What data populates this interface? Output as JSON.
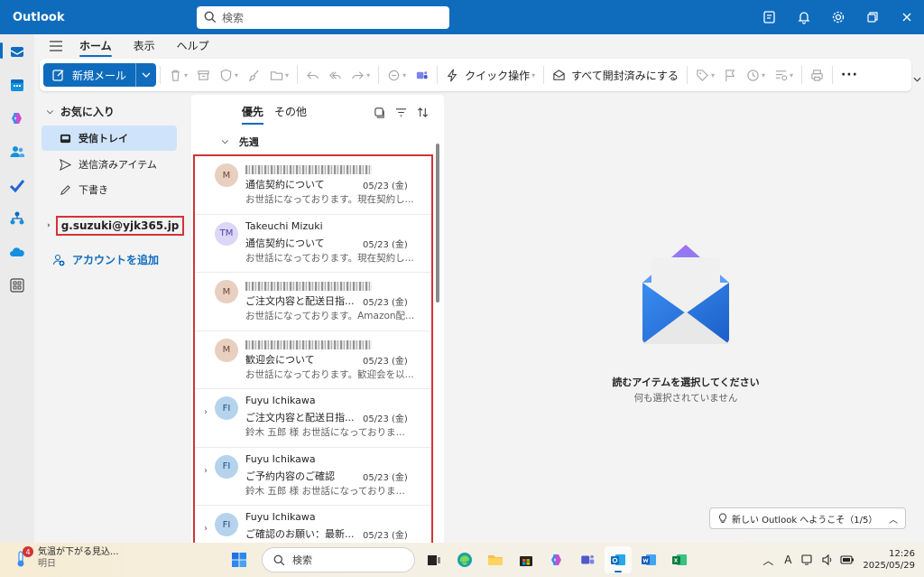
{
  "app": {
    "title": "Outlook"
  },
  "search": {
    "placeholder": "検索"
  },
  "ribbon": {
    "tabs": [
      "ホーム",
      "表示",
      "ヘルプ"
    ],
    "new_mail": "新規メール",
    "quick_steps": "クイック操作",
    "mark_all_read": "すべて開封済みにする"
  },
  "folders": {
    "favorites": "お気に入り",
    "items": [
      "受信トレイ",
      "送信済みアイテム",
      "下書き"
    ],
    "account": "g.suzuki@yjk365.jp",
    "add_account": "アカウントを追加"
  },
  "list": {
    "tabs": [
      "優先",
      "その他"
    ],
    "group": "先週",
    "messages": [
      {
        "initials": "M",
        "sender": "",
        "subject": "通信契約について",
        "date": "05/23 (金)",
        "preview": "お世話になっております。現在契約し...",
        "avatar_bg": "#e8cfc0",
        "avatar_fg": "#6a4a3a"
      },
      {
        "initials": "TM",
        "sender": "Takeuchi Mizuki",
        "subject": "通信契約について",
        "date": "05/23 (金)",
        "preview": "お世話になっております。現在契約し...",
        "avatar_bg": "#dcd6f7",
        "avatar_fg": "#4f46a3"
      },
      {
        "initials": "M",
        "sender": "",
        "subject": "ご注文内容と配送日指...",
        "date": "05/23 (金)",
        "preview": "お世話になっております。Amazon配...",
        "avatar_bg": "#e8cfc0",
        "avatar_fg": "#6a4a3a"
      },
      {
        "initials": "M",
        "sender": "",
        "subject": "歓迎会について",
        "date": "05/23 (金)",
        "preview": "お世話になっております。歓迎会を以...",
        "avatar_bg": "#e8cfc0",
        "avatar_fg": "#6a4a3a"
      },
      {
        "initials": "FI",
        "sender": "Fuyu Ichikawa",
        "subject": "ご注文内容と配送日指...",
        "date": "05/23 (金)",
        "preview": "鈴木 五郎 様 お世話になっておりま...",
        "avatar_bg": "#b6d3ee",
        "avatar_fg": "#1f4e79"
      },
      {
        "initials": "FI",
        "sender": "Fuyu Ichikawa",
        "subject": "ご予約内容のご確認",
        "date": "05/23 (金)",
        "preview": "鈴木 五郎 様 お世話になっておりま...",
        "avatar_bg": "#b6d3ee",
        "avatar_fg": "#1f4e79"
      },
      {
        "initials": "FI",
        "sender": "Fuyu Ichikawa",
        "subject": "ご確認のお願い：最新...",
        "date": "05/23 (金)",
        "preview": "",
        "avatar_bg": "#b6d3ee",
        "avatar_fg": "#1f4e79"
      }
    ]
  },
  "reading": {
    "empty_title": "読むアイテムを選択してください",
    "empty_sub": "何も選択されていません",
    "welcome": "新しい Outlook へようこそ（1/5）"
  },
  "taskbar": {
    "weather_badge": "4",
    "weather_text": "気温が下がる見込...",
    "weather_sub": "明日",
    "search": "検索",
    "time": "12:26",
    "date": "2025/05/29",
    "ime": "A"
  },
  "colors": {
    "accent": "#0f6cbd",
    "highlight": "#d13438",
    "selected": "#cfe4fa"
  }
}
